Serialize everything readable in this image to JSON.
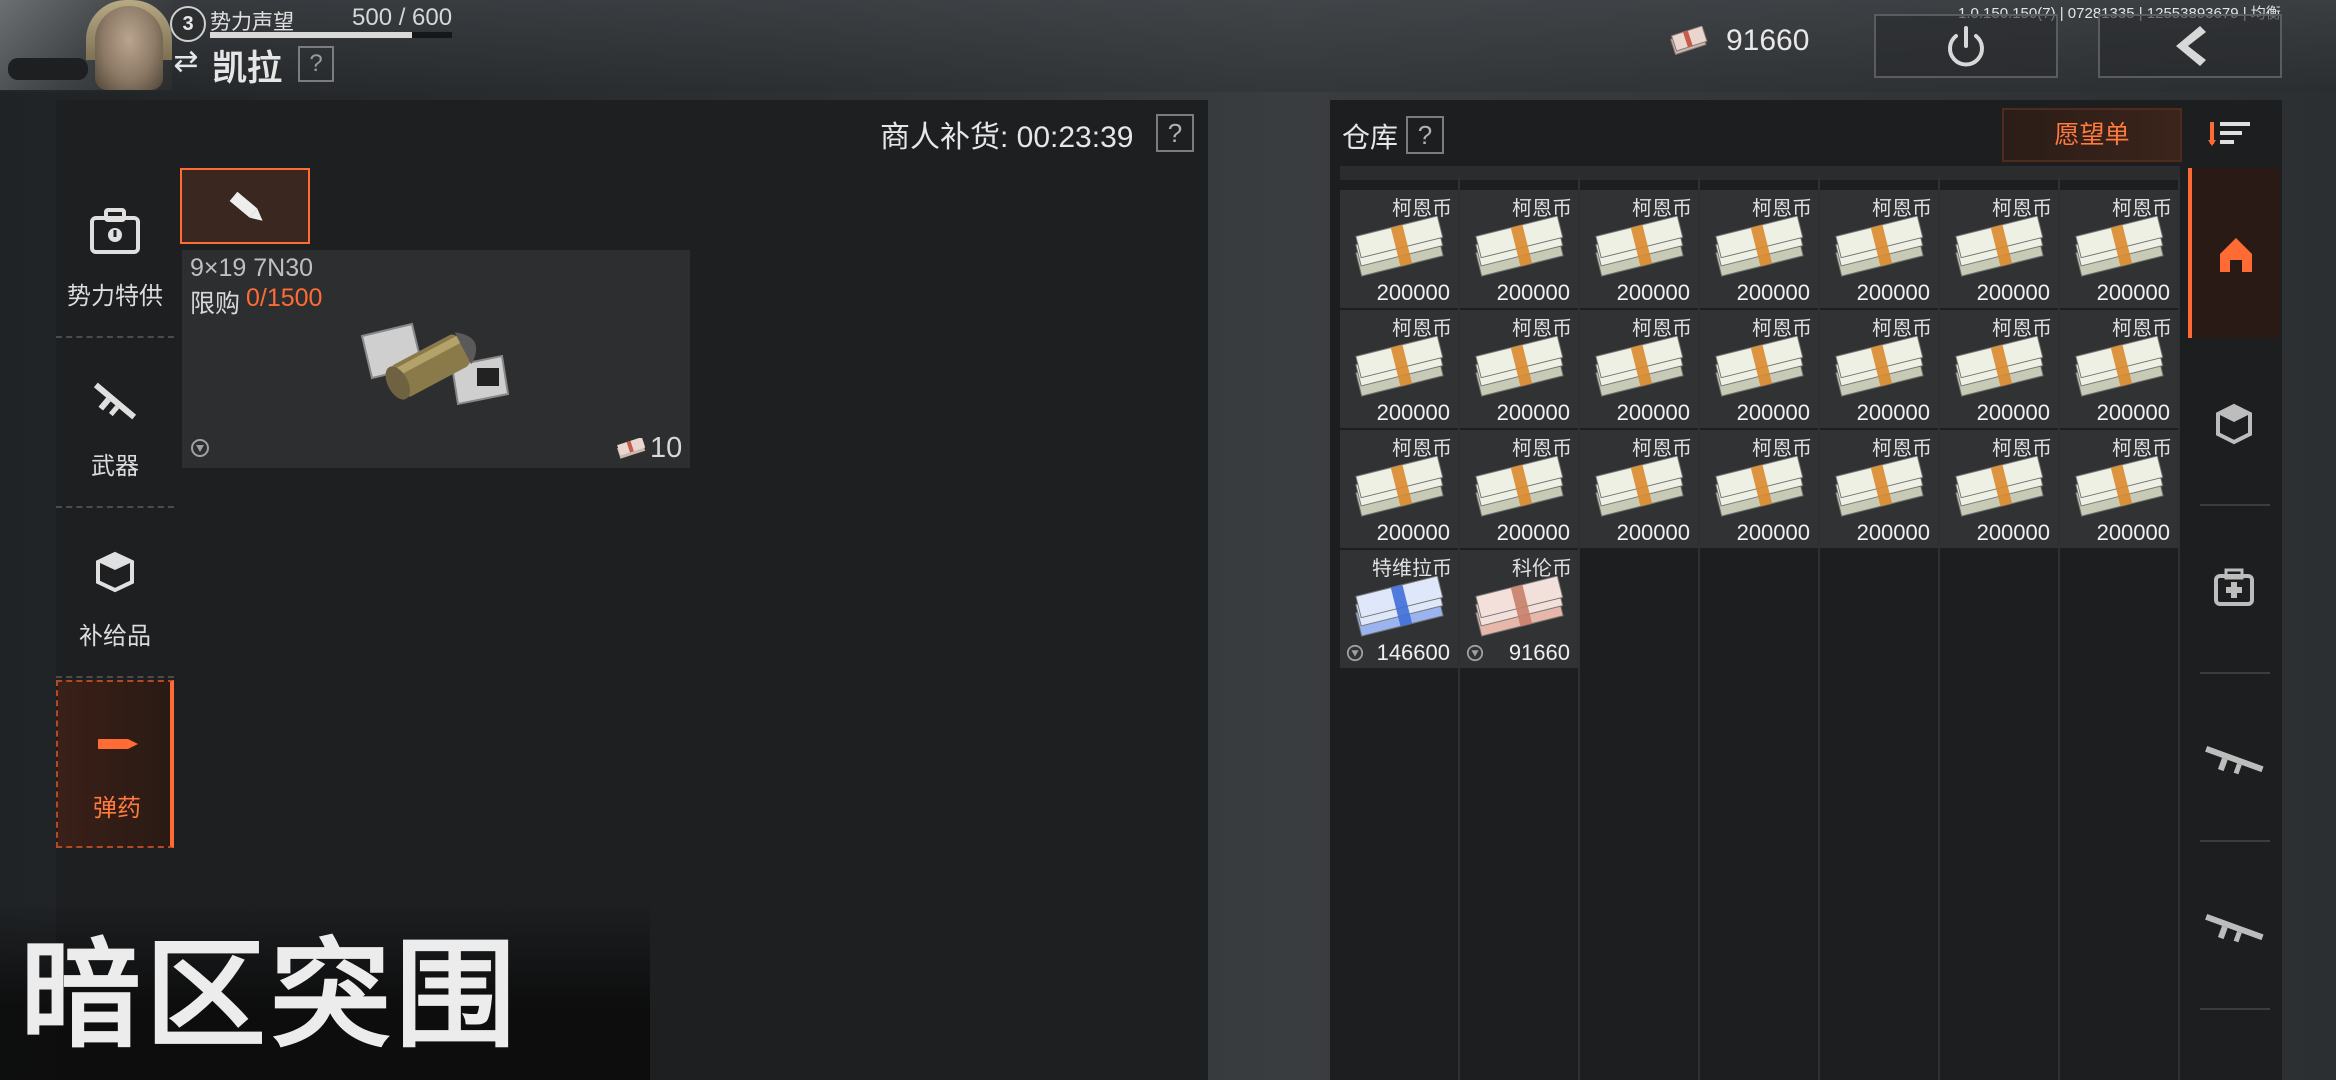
{
  "header": {
    "rank": "3",
    "faction_label": "势力声望",
    "reputation": "500 / 600",
    "reputation_progress": 0.8333,
    "player_name": "凯拉",
    "help": "?",
    "version_text": "1.0.150.150(7) | 07281335 | 12553893679 | 均衡",
    "money": "91660"
  },
  "merchant": {
    "restock_label": "商人补货: 00:23:39",
    "help": "?",
    "categories": [
      {
        "label": "势力特供",
        "icon": "briefcase-icon"
      },
      {
        "label": "武器",
        "icon": "rifle-icon"
      },
      {
        "label": "补给品",
        "icon": "supply-box-icon"
      },
      {
        "label": "弹药",
        "icon": "bullet-icon",
        "active": true
      }
    ],
    "item": {
      "name": "9×19 7N30",
      "limit_label": "限购",
      "limit_value": "0/1500",
      "price": "10"
    }
  },
  "warehouse": {
    "title": "仓库",
    "help": "?",
    "wishlist": "愿望单",
    "slots": [
      {
        "name": "柯恩币",
        "amount": "200000"
      },
      {
        "name": "柯恩币",
        "amount": "200000"
      },
      {
        "name": "柯恩币",
        "amount": "200000"
      },
      {
        "name": "柯恩币",
        "amount": "200000"
      },
      {
        "name": "柯恩币",
        "amount": "200000"
      },
      {
        "name": "柯恩币",
        "amount": "200000"
      },
      {
        "name": "柯恩币",
        "amount": "200000"
      },
      {
        "name": "柯恩币",
        "amount": "200000"
      },
      {
        "name": "柯恩币",
        "amount": "200000"
      },
      {
        "name": "柯恩币",
        "amount": "200000"
      },
      {
        "name": "柯恩币",
        "amount": "200000"
      },
      {
        "name": "柯恩币",
        "amount": "200000"
      },
      {
        "name": "柯恩币",
        "amount": "200000"
      },
      {
        "name": "柯恩币",
        "amount": "200000"
      },
      {
        "name": "柯恩币",
        "amount": "200000"
      },
      {
        "name": "柯恩币",
        "amount": "200000"
      },
      {
        "name": "柯恩币",
        "amount": "200000"
      },
      {
        "name": "柯恩币",
        "amount": "200000"
      },
      {
        "name": "柯恩币",
        "amount": "200000"
      },
      {
        "name": "柯恩币",
        "amount": "200000"
      },
      {
        "name": "柯恩币",
        "amount": "200000"
      },
      {
        "name": "特维拉币",
        "amount": "146600",
        "variant": "blue"
      },
      {
        "name": "科伦币",
        "amount": "91660",
        "variant": "pink"
      }
    ],
    "side_tabs": [
      "home-icon",
      "cube-icon",
      "medkit-icon",
      "rifle-icon",
      "rifle-icon"
    ]
  },
  "logo_text": "暗区突围",
  "colors": {
    "accent": "#ff6b35",
    "panel": "#1d1f21",
    "slot": "#303234"
  }
}
